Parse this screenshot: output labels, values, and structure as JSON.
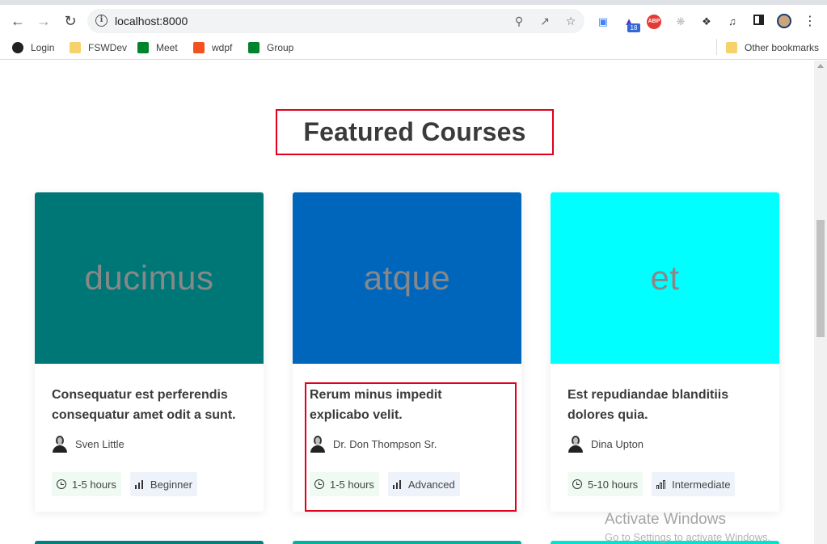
{
  "browser": {
    "url": "localhost:8000",
    "bookmarks": [
      {
        "label": "Login",
        "color": "#202124"
      },
      {
        "label": "FSWDev",
        "color": "#f6d26b"
      },
      {
        "label": "Meet",
        "color": "#00832d"
      },
      {
        "label": "wdpf",
        "color": "#f4511e"
      },
      {
        "label": "Group",
        "color": "#00832d"
      }
    ],
    "other_bookmarks": "Other bookmarks",
    "extension_badge": "18"
  },
  "section": {
    "title": "Featured Courses"
  },
  "courses": [
    {
      "thumb_text": "ducimus",
      "thumb_color": "#007777",
      "title": "Consequatur est perferendis consequatur amet odit a sunt.",
      "author": "Sven Little",
      "duration": "1-5 hours",
      "level": "Beginner"
    },
    {
      "thumb_text": "atque",
      "thumb_color": "#0066bb",
      "title": "Rerum minus impedit explicabo velit.",
      "author": "Dr. Don Thompson Sr.",
      "duration": "1-5 hours",
      "level": "Advanced"
    },
    {
      "thumb_text": "et",
      "thumb_color": "#00ffff",
      "title": "Est repudiandae blanditiis dolores quia.",
      "author": "Dina Upton",
      "duration": "5-10 hours",
      "level": "Intermediate"
    }
  ],
  "next_row_colors": [
    "#008080",
    "#00b3a0",
    "#00e5d0"
  ],
  "watermark": {
    "title": "Activate Windows",
    "subtitle": "Go to Settings to activate Windows."
  }
}
